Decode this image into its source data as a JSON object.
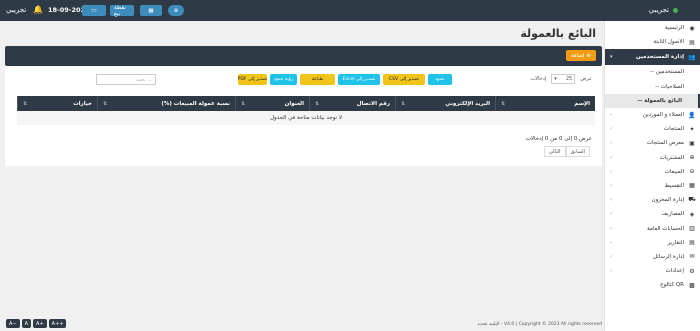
{
  "topbar": {
    "user": "تجريبي",
    "date": "18-09-2023",
    "pos_label": "نقطة بيع",
    "user_right": "تجريبي"
  },
  "page": {
    "title": "البائع بالعمولة"
  },
  "toolbar": {
    "add_label": "إضافة"
  },
  "filters": {
    "show": "عرض",
    "page_size": "25",
    "entries": "إدخالات",
    "search_placeholder": "بحث ..."
  },
  "export": {
    "cols": "عمود",
    "csv": "تصدير إلى CSV",
    "excel": "تصدير إلى Excel",
    "print": "طباعة",
    "visible": "رؤية عمود",
    "pdf": "تصدير إلى PDF"
  },
  "table": {
    "columns": [
      "الإسم",
      "البريد الإلكتروني",
      "رقم الاتصال",
      "العنوان",
      "نسبة عمولة المبيعات (%)",
      "خيارات"
    ],
    "empty": "لا توجد بيانات متاحة في الجدول"
  },
  "info": {
    "text": "عرض 0 إلى 0 من 0 إدخالات"
  },
  "pager": {
    "prev": "السابق",
    "next": "التالي"
  },
  "footer": {
    "text": "البلبيه تحديد - V4.0 | Copyright © 2023 All rights reserved"
  },
  "zoom": [
    "A−",
    "A",
    "A+",
    "A++"
  ],
  "sidebar": {
    "items": [
      {
        "label": "الرئيسية",
        "icon": "◉"
      },
      {
        "label": "الأصول الثابتة",
        "icon": "▤"
      },
      {
        "label": "إدارة المستخدمين",
        "icon": "👥"
      },
      {
        "label": "-- المستخدمين",
        "icon": ""
      },
      {
        "label": "-- الصلاحيات",
        "icon": ""
      },
      {
        "label": "-- البائع بالعمولة",
        "icon": ""
      },
      {
        "label": "العملاء و الموردين",
        "icon": "👤"
      },
      {
        "label": "المنتجات",
        "icon": "✦"
      },
      {
        "label": "معرض المنتجات",
        "icon": "▣"
      },
      {
        "label": "المشتريات",
        "icon": "⊕"
      },
      {
        "label": "المبيعات",
        "icon": "⊖"
      },
      {
        "label": "التقسيط",
        "icon": "▦"
      },
      {
        "label": "إدارة المخزون",
        "icon": "⛟"
      },
      {
        "label": "المصاريف",
        "icon": "◈"
      },
      {
        "label": "الحسابات العامة",
        "icon": "▥"
      },
      {
        "label": "التقارير",
        "icon": "▤"
      },
      {
        "label": "إدارة الرسائل",
        "icon": "✉"
      },
      {
        "label": "إعدادات",
        "icon": "⚙"
      },
      {
        "label": "كتالوج QR",
        "icon": "▩"
      }
    ]
  }
}
